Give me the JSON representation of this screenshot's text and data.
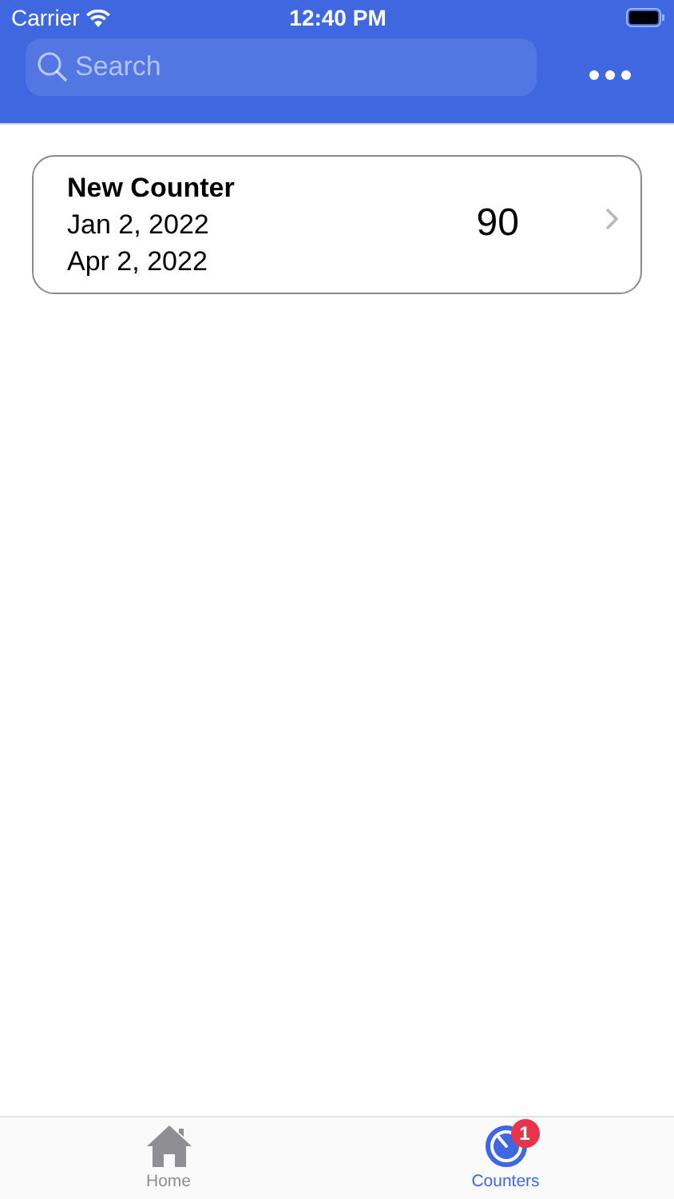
{
  "status_bar": {
    "carrier": "Carrier",
    "time": "12:40 PM"
  },
  "search": {
    "placeholder": "Search"
  },
  "counters": [
    {
      "title": "New Counter",
      "start": "Jan 2, 2022",
      "end": "Apr 2, 2022",
      "count": "90"
    }
  ],
  "tabs": [
    {
      "kind": "home",
      "label": "Home",
      "selected": false
    },
    {
      "kind": "counters",
      "label": "Counters",
      "selected": true,
      "badge": "1"
    }
  ]
}
